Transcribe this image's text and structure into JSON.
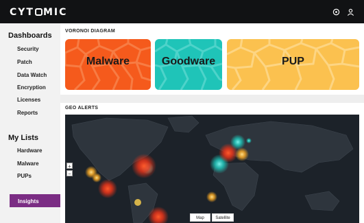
{
  "app": {
    "logo_text": "CYT",
    "logo_text_end": "MIC"
  },
  "topbar": {
    "icons": [
      "settings-icon",
      "user-icon"
    ]
  },
  "sidebar": {
    "sections": [
      {
        "title": "Dashboards",
        "items": [
          "Security",
          "Patch",
          "Data Watch",
          "Encryption",
          "Licenses",
          "Reports"
        ]
      },
      {
        "title": "My Lists",
        "items": [
          "Hardware",
          "Malware",
          "PUPs"
        ]
      }
    ],
    "active_item": "Insights"
  },
  "voronoi": {
    "title": "VORONOI DIAGRAM",
    "tiles": [
      {
        "label": "Malware",
        "color": "#f55a1c",
        "text_color": "#1a1a1a"
      },
      {
        "label": "Goodware",
        "color": "#1fc4b8",
        "text_color": "#1a1a1a"
      },
      {
        "label": "PUP",
        "color": "#fbc14f",
        "text_color": "#1a1a1a"
      }
    ]
  },
  "geo": {
    "title": "GEO ALERTS",
    "zoom_in": "+",
    "zoom_out": "−",
    "map_types": [
      "Map",
      "Satellite"
    ]
  },
  "colors": {
    "accent": "#7b2d84",
    "topbar": "#111214"
  }
}
